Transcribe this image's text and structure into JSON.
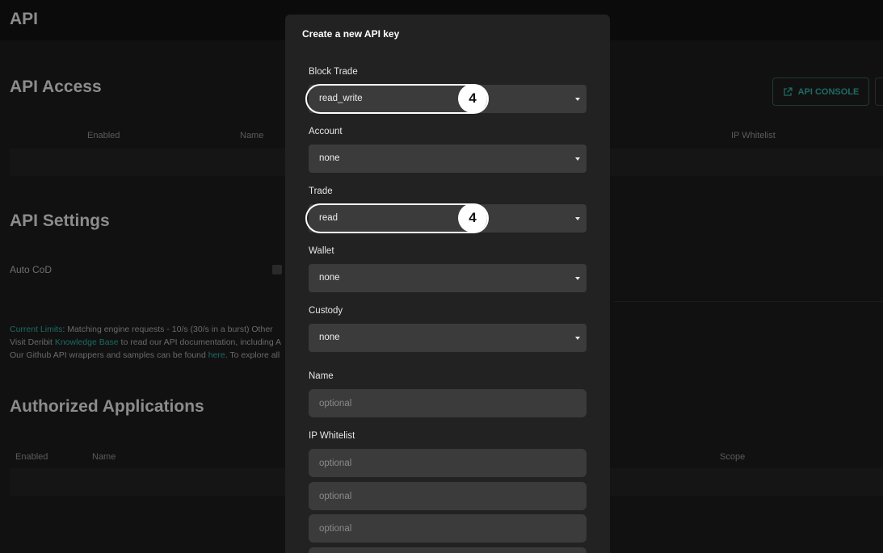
{
  "app": {
    "title": "API"
  },
  "api_access": {
    "title": "API Access",
    "columns": [
      "Enabled",
      "Name",
      "IP Whitelist"
    ],
    "console_button": "API CONSOLE"
  },
  "api_settings": {
    "title": "API Settings",
    "auto_cod_label": "Auto CoD"
  },
  "info": {
    "line1_link": "Current Limits",
    "line1_text": ": Matching engine requests - 10/s (30/s in a burst) Other",
    "line2_pre": "Visit Deribit ",
    "line2_link": "Knowledge Base",
    "line2_post": " to read our API documentation, including A",
    "line3_pre": "Our Github API wrappers and samples can be found ",
    "line3_link": "here",
    "line3_post": ". To explore all"
  },
  "authorized_apps": {
    "title": "Authorized Applications",
    "columns": [
      "Enabled",
      "Name",
      "Scope"
    ]
  },
  "modal": {
    "title": "Create a new API key",
    "fields": [
      {
        "label": "Block Trade",
        "value": "read_write"
      },
      {
        "label": "Account",
        "value": "none"
      },
      {
        "label": "Trade",
        "value": "read"
      },
      {
        "label": "Wallet",
        "value": "none"
      },
      {
        "label": "Custody",
        "value": "none"
      }
    ],
    "name_label": "Name",
    "name_placeholder": "optional",
    "ip_whitelist_label": "IP Whitelist",
    "ip_whitelist_placeholders": [
      "optional",
      "optional",
      "optional"
    ]
  },
  "annotations": [
    {
      "badge": "4",
      "target": "Block Trade"
    },
    {
      "badge": "4",
      "target": "Trade"
    }
  ],
  "colors": {
    "accent": "#1d6a62",
    "modal_bg": "#222222",
    "field_bg": "#3b3b3b",
    "highlight": "#ffffff"
  }
}
